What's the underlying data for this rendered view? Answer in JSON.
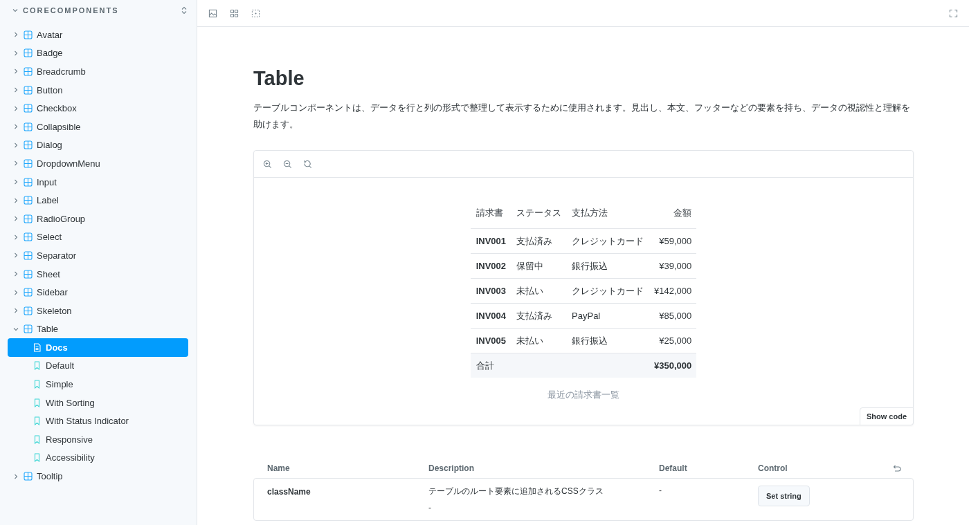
{
  "sidebar": {
    "section_title": "CORECOMPONENTS",
    "section_expanded": true,
    "items": [
      {
        "label": "Avatar",
        "expanded": false
      },
      {
        "label": "Badge",
        "expanded": false
      },
      {
        "label": "Breadcrumb",
        "expanded": false
      },
      {
        "label": "Button",
        "expanded": false
      },
      {
        "label": "Checkbox",
        "expanded": false
      },
      {
        "label": "Collapsible",
        "expanded": false
      },
      {
        "label": "Dialog",
        "expanded": false
      },
      {
        "label": "DropdownMenu",
        "expanded": false
      },
      {
        "label": "Input",
        "expanded": false
      },
      {
        "label": "Label",
        "expanded": false
      },
      {
        "label": "RadioGroup",
        "expanded": false
      },
      {
        "label": "Select",
        "expanded": false
      },
      {
        "label": "Separator",
        "expanded": false
      },
      {
        "label": "Sheet",
        "expanded": false
      },
      {
        "label": "Sidebar",
        "expanded": false
      },
      {
        "label": "Skeleton",
        "expanded": false
      },
      {
        "label": "Table",
        "expanded": true,
        "children": [
          {
            "label": "Docs",
            "kind": "docs",
            "selected": true
          },
          {
            "label": "Default",
            "kind": "story",
            "selected": false
          },
          {
            "label": "Simple",
            "kind": "story",
            "selected": false
          },
          {
            "label": "With Sorting",
            "kind": "story",
            "selected": false
          },
          {
            "label": "With Status Indicator",
            "kind": "story",
            "selected": false
          },
          {
            "label": "Responsive",
            "kind": "story",
            "selected": false
          },
          {
            "label": "Accessibility",
            "kind": "story",
            "selected": false
          }
        ]
      },
      {
        "label": "Tooltip",
        "expanded": false
      }
    ]
  },
  "doc": {
    "title": "Table",
    "description": "テーブルコンポーネントは、データを行と列の形式で整理して表示するために使用されます。見出し、本文、フッターなどの要素を持ち、データの視認性と理解を助けます。",
    "preview": {
      "table": {
        "columns": [
          "請求書",
          "ステータス",
          "支払方法",
          "金額"
        ],
        "rows": [
          [
            "INV001",
            "支払済み",
            "クレジットカード",
            "¥59,000"
          ],
          [
            "INV002",
            "保留中",
            "銀行振込",
            "¥39,000"
          ],
          [
            "INV003",
            "未払い",
            "クレジットカード",
            "¥142,000"
          ],
          [
            "INV004",
            "支払済み",
            "PayPal",
            "¥85,000"
          ],
          [
            "INV005",
            "未払い",
            "銀行振込",
            "¥25,000"
          ]
        ],
        "footer": {
          "label": "合計",
          "value": "¥350,000"
        },
        "caption": "最近の請求書一覧"
      },
      "show_code": "Show code"
    },
    "args_table": {
      "columns": [
        "Name",
        "Description",
        "Default",
        "Control"
      ],
      "rows": [
        {
          "name": "className",
          "description": "テーブルのルート要素に追加されるCSSクラス",
          "type_summary": "-",
          "default": "-",
          "control": "Set string"
        }
      ]
    }
  }
}
